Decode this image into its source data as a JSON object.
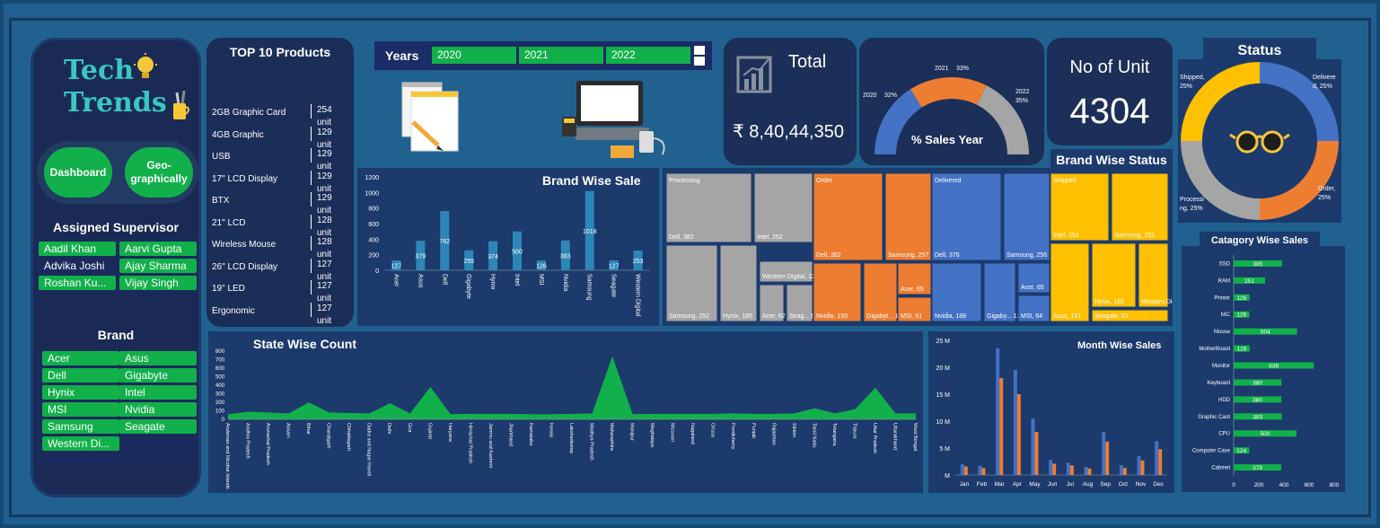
{
  "app": {
    "logo_line1": "Tech",
    "logo_line2": "Trends"
  },
  "nav": {
    "dashboard": "Dashboard",
    "geo": "Geo-\ngraphically"
  },
  "supervisor": {
    "title": "Assigned Supervisor",
    "items": [
      {
        "label": "Aadil Khan",
        "selected": true
      },
      {
        "label": "Aarvi Gupta",
        "selected": true
      },
      {
        "label": "Advika Joshi",
        "selected": false
      },
      {
        "label": "Ajay Sharma",
        "selected": true
      },
      {
        "label": "Roshan Ku...",
        "selected": true
      },
      {
        "label": "Vijay Singh",
        "selected": true
      }
    ]
  },
  "brand": {
    "title": "Brand",
    "items": [
      {
        "label": "Acer",
        "selected": true
      },
      {
        "label": "Asus",
        "selected": true
      },
      {
        "label": "Dell",
        "selected": true
      },
      {
        "label": "Gigabyte",
        "selected": true
      },
      {
        "label": "Hynix",
        "selected": true
      },
      {
        "label": "Intel",
        "selected": true
      },
      {
        "label": "MSI",
        "selected": true
      },
      {
        "label": "Nvidia",
        "selected": true
      },
      {
        "label": "Samsung",
        "selected": true
      },
      {
        "label": "Seagate",
        "selected": true
      },
      {
        "label": "Western Di...",
        "selected": true
      }
    ]
  },
  "top_products": {
    "title": "TOP 10 Products",
    "rows": [
      {
        "name": "2GB Graphic Card",
        "value": "254 unit"
      },
      {
        "name": "4GB Graphic",
        "value": "129 unit"
      },
      {
        "name": "USB",
        "value": "129 unit"
      },
      {
        "name": "17\" LCD Display",
        "value": "129 unit"
      },
      {
        "name": "BTX",
        "value": "129 unit"
      },
      {
        "name": "21\" LCD",
        "value": "128 unit"
      },
      {
        "name": "Wireless Mouse",
        "value": "128 unit"
      },
      {
        "name": "26\" LCD Display",
        "value": "127 unit"
      },
      {
        "name": "19\" LED",
        "value": "127 unit"
      },
      {
        "name": "Ergonomic",
        "value": "127 unit"
      }
    ]
  },
  "years": {
    "label": "Years",
    "options": [
      "2020",
      "2021",
      "2022"
    ]
  },
  "kpis": {
    "total_label": "Total",
    "total_value": "₹ 8,40,44,350",
    "units_label": "No of Unit",
    "units_value": "4304"
  },
  "sales_year": {
    "title": "% Sales Year",
    "segments": [
      {
        "year": "2020",
        "pct": "32%",
        "value": 32,
        "color": "#4472c4"
      },
      {
        "year": "2021",
        "pct": "33%",
        "value": 33,
        "color": "#ed7d31"
      },
      {
        "year": "2022",
        "pct": "35%",
        "value": 35,
        "color": "#a5a5a5"
      }
    ]
  },
  "status": {
    "title": "Status",
    "segments": [
      {
        "label": "Shipped,\n25%",
        "value": 25,
        "color": "#ffc000"
      },
      {
        "label": "Delivere\nd, 25%",
        "value": 25,
        "color": "#4472c4"
      },
      {
        "label": "Order,\n25%",
        "value": 25,
        "color": "#ed7d31"
      },
      {
        "label": "Processi\nng, 25%",
        "value": 25,
        "color": "#a5a5a5"
      }
    ]
  },
  "brand_status": {
    "title": "Brand Wise Status",
    "groups": [
      {
        "name": "Processing",
        "color": "#a5a5a5",
        "cells": [
          "Dell, 382",
          "Intel, 252",
          "Samsung, 252",
          "Hynix, 185",
          "Western Digital, 129",
          "Acer, 62",
          "Seag... 61"
        ]
      },
      {
        "name": "Order",
        "color": "#ed7d31",
        "cells": [
          "Dell, 382",
          "Samsung, 257",
          "Nvidia, 193",
          "Gigabyt... 127",
          "Acer, 65",
          "MSI, 61"
        ]
      },
      {
        "name": "Delivered",
        "color": "#4472c4",
        "cells": [
          "Dell, 376",
          "Samsung, 256",
          "Nvidia, 188",
          "Gigaby... 127",
          "Acer, 65",
          "MSI, 64"
        ]
      },
      {
        "name": "Shipped",
        "color": "#ffc000",
        "cells": [
          "Intel, 252",
          "Samsung, 252",
          "Asus, 191",
          "Hynix, 185",
          "Western Digital, 129",
          "Seagate, 61"
        ]
      }
    ]
  },
  "chart_data": [
    {
      "type": "bar",
      "title": "Brand Wise Sale",
      "categories": [
        "Acer",
        "Asus",
        "Dell",
        "Gigabyte",
        "Hynix",
        "Intel",
        "MSI",
        "Nvidia",
        "Samsung",
        "Seagate",
        "Western Digital"
      ],
      "values": [
        127,
        379,
        762,
        255,
        374,
        500,
        126,
        383,
        1018,
        127,
        253
      ],
      "ylim": [
        0,
        1200
      ],
      "yticks": [
        0,
        200,
        400,
        600,
        800,
        1000,
        1200
      ],
      "color": "#2e86b8"
    },
    {
      "type": "area",
      "title": "State Wise Count",
      "categories": [
        "Andaman and Nicobar Islands",
        "Andhra Pradesh",
        "Arunachal Pradesh",
        "Assam",
        "Bihar",
        "Chandigarh",
        "Chhattisgarh",
        "Dadra and Nagar Haveli",
        "Delhi",
        "Goa",
        "Gujarat",
        "Haryana",
        "Himachal Pradesh",
        "Jammu and Kashmir",
        "Jharkhand",
        "Karnataka",
        "Kerala",
        "Lakshadweep",
        "Madhya Pradesh",
        "Maharashtra",
        "Manipur",
        "Meghalaya",
        "Mizoram",
        "Nagaland",
        "Orissa",
        "Pondicherry",
        "Punjab",
        "Rajasthan",
        "Sikkim",
        "Tamil Nadu",
        "Telangana",
        "Tripura",
        "Uttar Pradesh",
        "Uttarakhand",
        "West Bengal"
      ],
      "values": [
        60,
        90,
        80,
        70,
        200,
        80,
        75,
        70,
        190,
        70,
        380,
        60,
        65,
        65,
        65,
        60,
        60,
        65,
        70,
        740,
        60,
        65,
        65,
        65,
        65,
        70,
        65,
        65,
        70,
        130,
        70,
        120,
        370,
        70,
        70
      ],
      "ylim": [
        0,
        800
      ],
      "yticks": [
        0,
        100,
        200,
        300,
        400,
        500,
        600,
        700,
        800
      ],
      "color": "#12b04a"
    },
    {
      "type": "bar",
      "title": "Month Wise Sales",
      "categories": [
        "Jan",
        "Feb",
        "Mar",
        "Apr",
        "May",
        "Jun",
        "Jul",
        "Aug",
        "Sep",
        "Oct",
        "Nov",
        "Dec"
      ],
      "series": [
        {
          "values": [
            2.0,
            1.7,
            23.5,
            19.5,
            10.5,
            2.8,
            2.3,
            1.5,
            8.0,
            1.8,
            3.5,
            6.3
          ],
          "color": "#4472c4"
        },
        {
          "values": [
            1.6,
            1.3,
            18.0,
            15.0,
            8.0,
            2.1,
            1.8,
            1.2,
            6.2,
            1.3,
            2.7,
            4.8
          ],
          "color": "#ed7d31"
        }
      ],
      "ylim": [
        0,
        25
      ],
      "yticks": [
        "M",
        "5 M",
        "10 M",
        "15 M",
        "20 M",
        "25 M"
      ]
    },
    {
      "type": "bar",
      "title": "Catagory Wise Sales",
      "orientation": "horizontal",
      "categories": [
        "SSD",
        "RAM",
        "Printer",
        "NIC",
        "Mouse",
        "MotherBoard",
        "Monitor",
        "Keyboard",
        "HDD",
        "Graphic Card",
        "CPU",
        "Computer Case",
        "Cabinet"
      ],
      "values": [
        385,
        251,
        126,
        126,
        504,
        128,
        638,
        380,
        380,
        383,
        500,
        124,
        379
      ],
      "xlim": [
        0,
        800
      ],
      "xticks": [
        0,
        200,
        400,
        600,
        800
      ],
      "color": "#12b04a"
    }
  ]
}
